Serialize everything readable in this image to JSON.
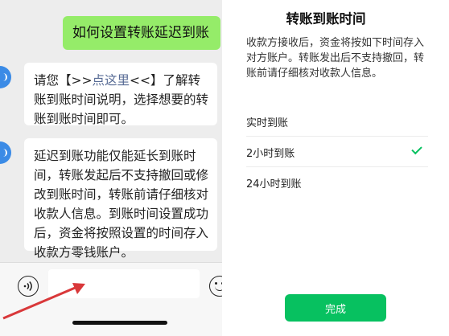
{
  "chat": {
    "user_message": "如何设置转账延迟到账",
    "bot_message_1": {
      "prefix": "请您【>>",
      "link": "点这里",
      "suffix": "<<】了解转账到账时间说明，选择想要的转账到账时间即可。"
    },
    "bot_message_2": "延迟到账功能仅能延长到账时间，转账发起后不支持撤回或修改到账时间，转账前请仔细核对收款人信息。到账时间设置成功后，资金将按照设置的时间存入收款方零钱账户。",
    "input": {
      "placeholder": ""
    },
    "icons": {
      "voice": "voice-icon",
      "emoji": "emoji-icon"
    },
    "colors": {
      "user_bubble": "#95ec69",
      "link": "#576b95",
      "annotation_arrow": "#d9383a"
    }
  },
  "sheet": {
    "title": "转账到账时间",
    "description": "收款方接收后，资金将按如下时间存入对方账户。转账发出后不支持撤回，转账前请仔细核对收款人信息。",
    "options": [
      {
        "label": "实时到账",
        "selected": false
      },
      {
        "label": "2小时到账",
        "selected": true
      },
      {
        "label": "24小时到账",
        "selected": false
      }
    ],
    "done_label": "完成",
    "colors": {
      "accent": "#07c160"
    }
  }
}
